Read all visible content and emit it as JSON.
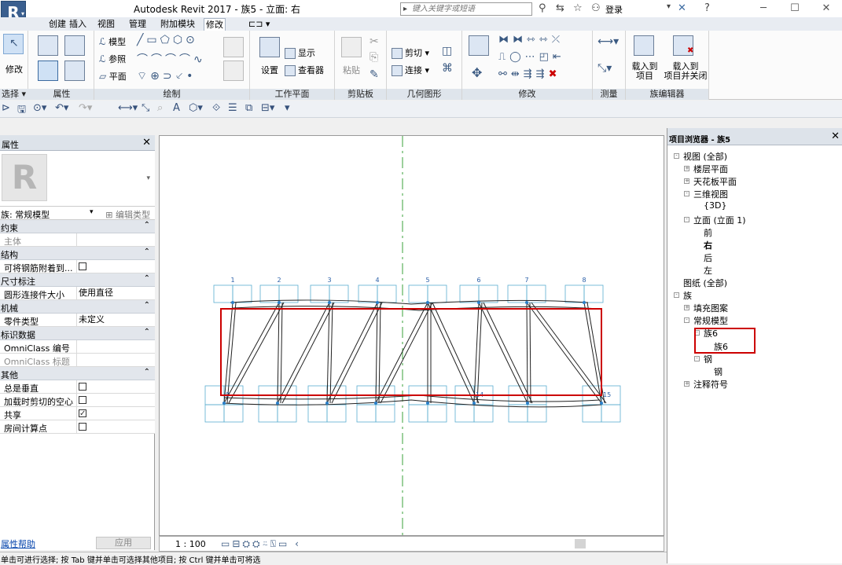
{
  "app": {
    "title": "Autodesk Revit 2017 -     族5 - 立面: 右",
    "logo": "R",
    "search_placeholder": "键入关键字或短语",
    "login": "登录",
    "icons": [
      "binoculars-icon",
      "exchange-icon",
      "star-icon",
      "user-icon",
      "x-icon",
      "help-icon"
    ]
  },
  "ribbon": {
    "tabs": [
      "创建",
      "插入",
      "视图",
      "管理",
      "附加模块",
      "修改"
    ],
    "active_tab": "修改",
    "panels": {
      "select": {
        "label": "选择 ▾",
        "modify": "修改"
      },
      "properties": {
        "label": "属性"
      },
      "draw": {
        "label": "绘制",
        "model": "模型",
        "reference": "参照",
        "plane": "平面"
      },
      "workplane": {
        "label": "工作平面",
        "set": "设置",
        "show": "显示",
        "viewer": "查看器"
      },
      "clipboard": {
        "label": "剪贴板",
        "paste": "粘贴"
      },
      "geometry": {
        "label": "几何图形",
        "cut": "剪切",
        "join": "连接"
      },
      "modify": {
        "label": "修改"
      },
      "measure": {
        "label": "测量"
      },
      "family_editor": {
        "label": "族编辑器",
        "load_to_project": "载入到\n项目",
        "load_and_close": "载入到\n项目并关闭"
      }
    }
  },
  "properties": {
    "title": "属性",
    "family": "族: 常规模型",
    "edit_type": "编辑类型",
    "groups": [
      {
        "name": "约束",
        "rows": [
          {
            "name": "主体",
            "value": "",
            "disabled": true
          }
        ]
      },
      {
        "name": "结构",
        "rows": [
          {
            "name": "可将钢筋附着到...",
            "value": "checkbox_off"
          }
        ]
      },
      {
        "name": "尺寸标注",
        "rows": [
          {
            "name": "圆形连接件大小",
            "value": "使用直径"
          }
        ]
      },
      {
        "name": "机械",
        "rows": [
          {
            "name": "零件类型",
            "value": "未定义"
          }
        ]
      },
      {
        "name": "标识数据",
        "rows": [
          {
            "name": "OmniClass 编号",
            "value": ""
          },
          {
            "name": "OmniClass 标题",
            "value": "",
            "disabled": true
          }
        ]
      },
      {
        "name": "其他",
        "rows": [
          {
            "name": "总是垂直",
            "value": "checkbox_off"
          },
          {
            "name": "加载时剪切的空心",
            "value": "checkbox_off"
          },
          {
            "name": "共享",
            "value": "checkbox_on"
          },
          {
            "name": "房间计算点",
            "value": "checkbox_off"
          }
        ]
      }
    ],
    "help": "属性帮助",
    "apply": "应用"
  },
  "canvas": {
    "scale": "1 : 100",
    "top_labels": [
      "1",
      "2",
      "3",
      "4",
      "5",
      "6",
      "7",
      "8"
    ],
    "bottom_labels": [
      "9",
      "14",
      "15"
    ]
  },
  "browser": {
    "title": "项目浏览器 - 族5",
    "tree": [
      {
        "label": "视图 (全部)",
        "level": 0,
        "exp": "-"
      },
      {
        "label": "楼层平面",
        "level": 1,
        "exp": "+"
      },
      {
        "label": "天花板平面",
        "level": 1,
        "exp": "+"
      },
      {
        "label": "三维视图",
        "level": 1,
        "exp": "-"
      },
      {
        "label": "{3D}",
        "level": 2
      },
      {
        "label": "立面 (立面 1)",
        "level": 1,
        "exp": "-"
      },
      {
        "label": "前",
        "level": 2
      },
      {
        "label": "右",
        "level": 2,
        "bold": true
      },
      {
        "label": "后",
        "level": 2
      },
      {
        "label": "左",
        "level": 2
      },
      {
        "label": "图纸 (全部)",
        "level": 0
      },
      {
        "label": "族",
        "level": 0,
        "exp": "-"
      },
      {
        "label": "填充图案",
        "level": 1,
        "exp": "+"
      },
      {
        "label": "常规模型",
        "level": 1,
        "exp": "-"
      },
      {
        "label": "族6",
        "level": 2,
        "exp": "-"
      },
      {
        "label": "族6",
        "level": 3
      },
      {
        "label": "钢",
        "level": 2,
        "exp": "-"
      },
      {
        "label": "钢",
        "level": 3
      },
      {
        "label": "注释符号",
        "level": 1,
        "exp": "+"
      }
    ]
  },
  "status": {
    "text": "单击可进行选择; 按 Tab 键并单击可选择其他项目; 按 Ctrl 键并单击可将选"
  },
  "colors": {
    "highlight": "#cc0000",
    "centerline": "#3aa13a",
    "grip": "#5aaed0"
  }
}
